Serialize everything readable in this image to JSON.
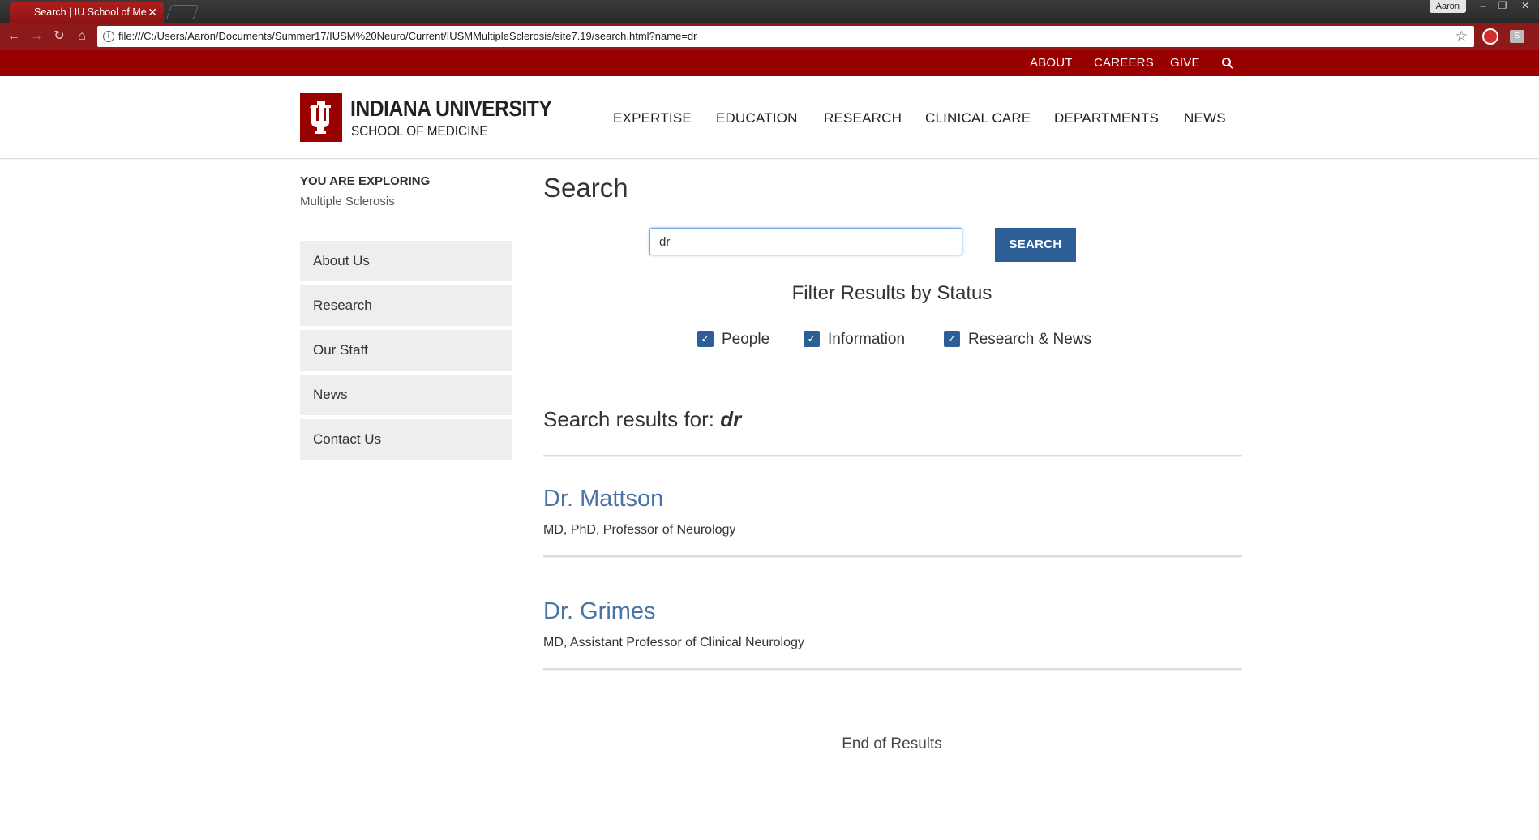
{
  "browser": {
    "tab_title": "Search | IU School of Me",
    "tab_close": "✕",
    "user_name": "Aaron",
    "url": "file:///C:/Users/Aaron/Documents/Summer17/IUSM%20Neuro/Current/IUSMMultipleSclerosis/site7.19/search.html?name=dr",
    "icons": [
      "back-icon",
      "forward-icon",
      "reload-icon",
      "home-icon",
      "info-icon",
      "star-icon"
    ]
  },
  "utility_nav": [
    "ABOUT",
    "CAREERS",
    "GIVE"
  ],
  "logo": {
    "line1": "INDIANA UNIVERSITY",
    "line2": "SCHOOL OF MEDICINE",
    "color": "#990000"
  },
  "main_nav": [
    "EXPERTISE",
    "EDUCATION",
    "RESEARCH",
    "CLINICAL CARE",
    "DEPARTMENTS",
    "NEWS"
  ],
  "sidebar": {
    "exploring_label": "YOU ARE EXPLORING",
    "exploring_value": "Multiple Sclerosis",
    "items": [
      "About Us",
      "Research",
      "Our Staff",
      "News",
      "Contact Us"
    ]
  },
  "main": {
    "title": "Search",
    "search_value": "dr",
    "search_button": "SEARCH",
    "filter_title": "Filter Results by Status",
    "filters": [
      {
        "label": "People",
        "checked": true
      },
      {
        "label": "Information",
        "checked": true
      },
      {
        "label": "Research & News",
        "checked": true
      }
    ],
    "results_prefix": "Search results for:",
    "results_query": "dr",
    "results": [
      {
        "name": "Dr. Mattson",
        "desc": "MD, PhD, Professor of Neurology"
      },
      {
        "name": "Dr. Grimes",
        "desc": "MD, Assistant Professor of Clinical Neurology"
      }
    ],
    "end_text": "End of Results"
  },
  "colors": {
    "crimson": "#990000",
    "button_blue": "#2d5f96",
    "link_blue": "#4a72a6"
  }
}
